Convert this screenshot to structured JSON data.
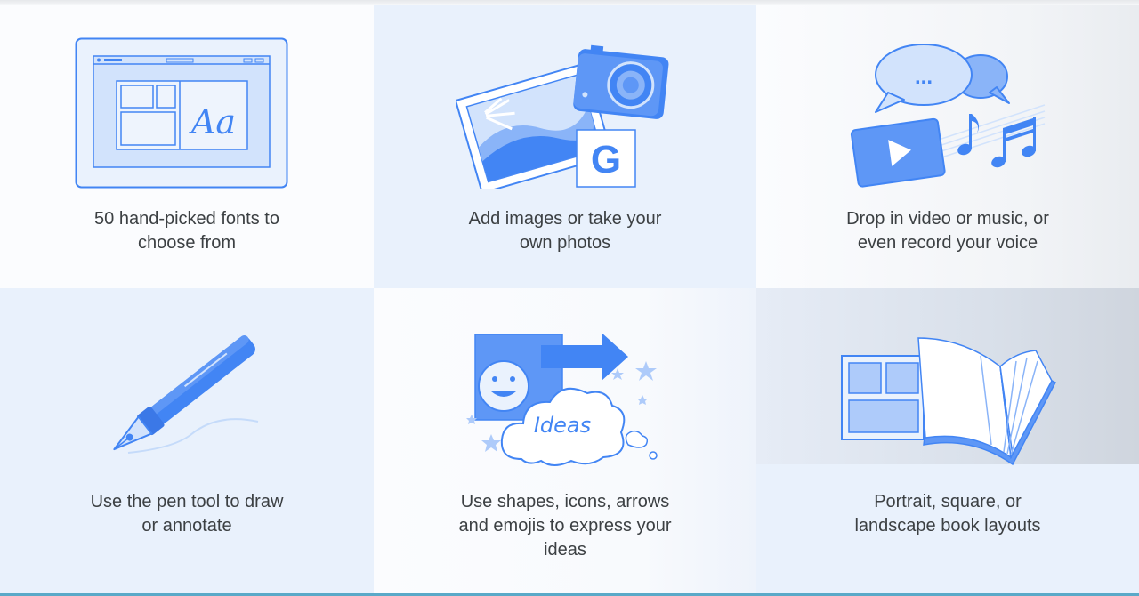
{
  "features": [
    {
      "caption": [
        "50 hand-picked fonts to",
        "choose from"
      ],
      "icon": "font-sample-icon",
      "sample_text": "Aa"
    },
    {
      "caption": [
        "Add images or take your",
        "own photos"
      ],
      "icon": "photo-camera-icon",
      "logo_letter": "G"
    },
    {
      "caption": [
        "Drop in video or music, or",
        "even record your voice"
      ],
      "icon": "media-icon",
      "bubble_text": "..."
    },
    {
      "caption": [
        "Use the pen tool to draw",
        "or annotate"
      ],
      "icon": "pen-icon"
    },
    {
      "caption": [
        "Use shapes, icons, arrows",
        "and emojis to express your",
        "ideas"
      ],
      "icon": "shapes-emoji-icon",
      "cloud_text": "Ideas"
    },
    {
      "caption": [
        "Portrait, square, or",
        "landscape book layouts"
      ],
      "icon": "book-layout-icon"
    }
  ],
  "colors": {
    "accent_blue": "#4285f4",
    "light_blue": "#8ab4f8",
    "pale_blue": "#d2e3fc",
    "text": "#3c4043"
  }
}
